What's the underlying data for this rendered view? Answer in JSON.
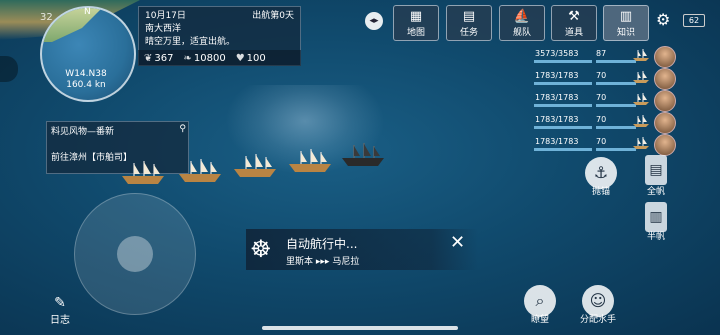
{
  "minimap": {
    "level": "32",
    "north": "N",
    "coord": "W14.N38",
    "distance": "160.4 kn"
  },
  "voyage": {
    "date": "10月17日",
    "days": "出航第0天",
    "location": "南大西洋",
    "weather": "晴空万里，适宜出航。"
  },
  "resources": {
    "food": "367",
    "water": "10800",
    "health": "100"
  },
  "top_menu": [
    {
      "label": "地图",
      "icon": "map-icon",
      "glyph": "▦"
    },
    {
      "label": "任务",
      "icon": "scroll-icon",
      "glyph": "▤"
    },
    {
      "label": "舰队",
      "icon": "sail-icon",
      "glyph": "⛵"
    },
    {
      "label": "道具",
      "icon": "tools-icon",
      "glyph": "⚒"
    },
    {
      "label": "知识",
      "icon": "book-icon",
      "glyph": "▥"
    }
  ],
  "battery": "62",
  "fleet": [
    {
      "hp": "3573/3583",
      "crew": "87"
    },
    {
      "hp": "1783/1783",
      "crew": "70"
    },
    {
      "hp": "1783/1783",
      "crew": "70"
    },
    {
      "hp": "1783/1783",
      "crew": "70"
    },
    {
      "hp": "1783/1783",
      "crew": "70"
    }
  ],
  "quest": {
    "title": "料见风物—番新",
    "desc": "前往漳州【市舶司】"
  },
  "autonav": {
    "title": "自动航行中...",
    "from": "里斯本",
    "arrows": "▸▸▸",
    "to": "马尼拉"
  },
  "actions": {
    "anchor": "抛锚",
    "full_sail": "全帆",
    "half_sail": "半帆",
    "lookout": "瞭望",
    "assign_crew": "分配水手"
  },
  "log": "日志",
  "colors": {
    "accent": "#6fb2d8",
    "sea": "#104a6d"
  }
}
